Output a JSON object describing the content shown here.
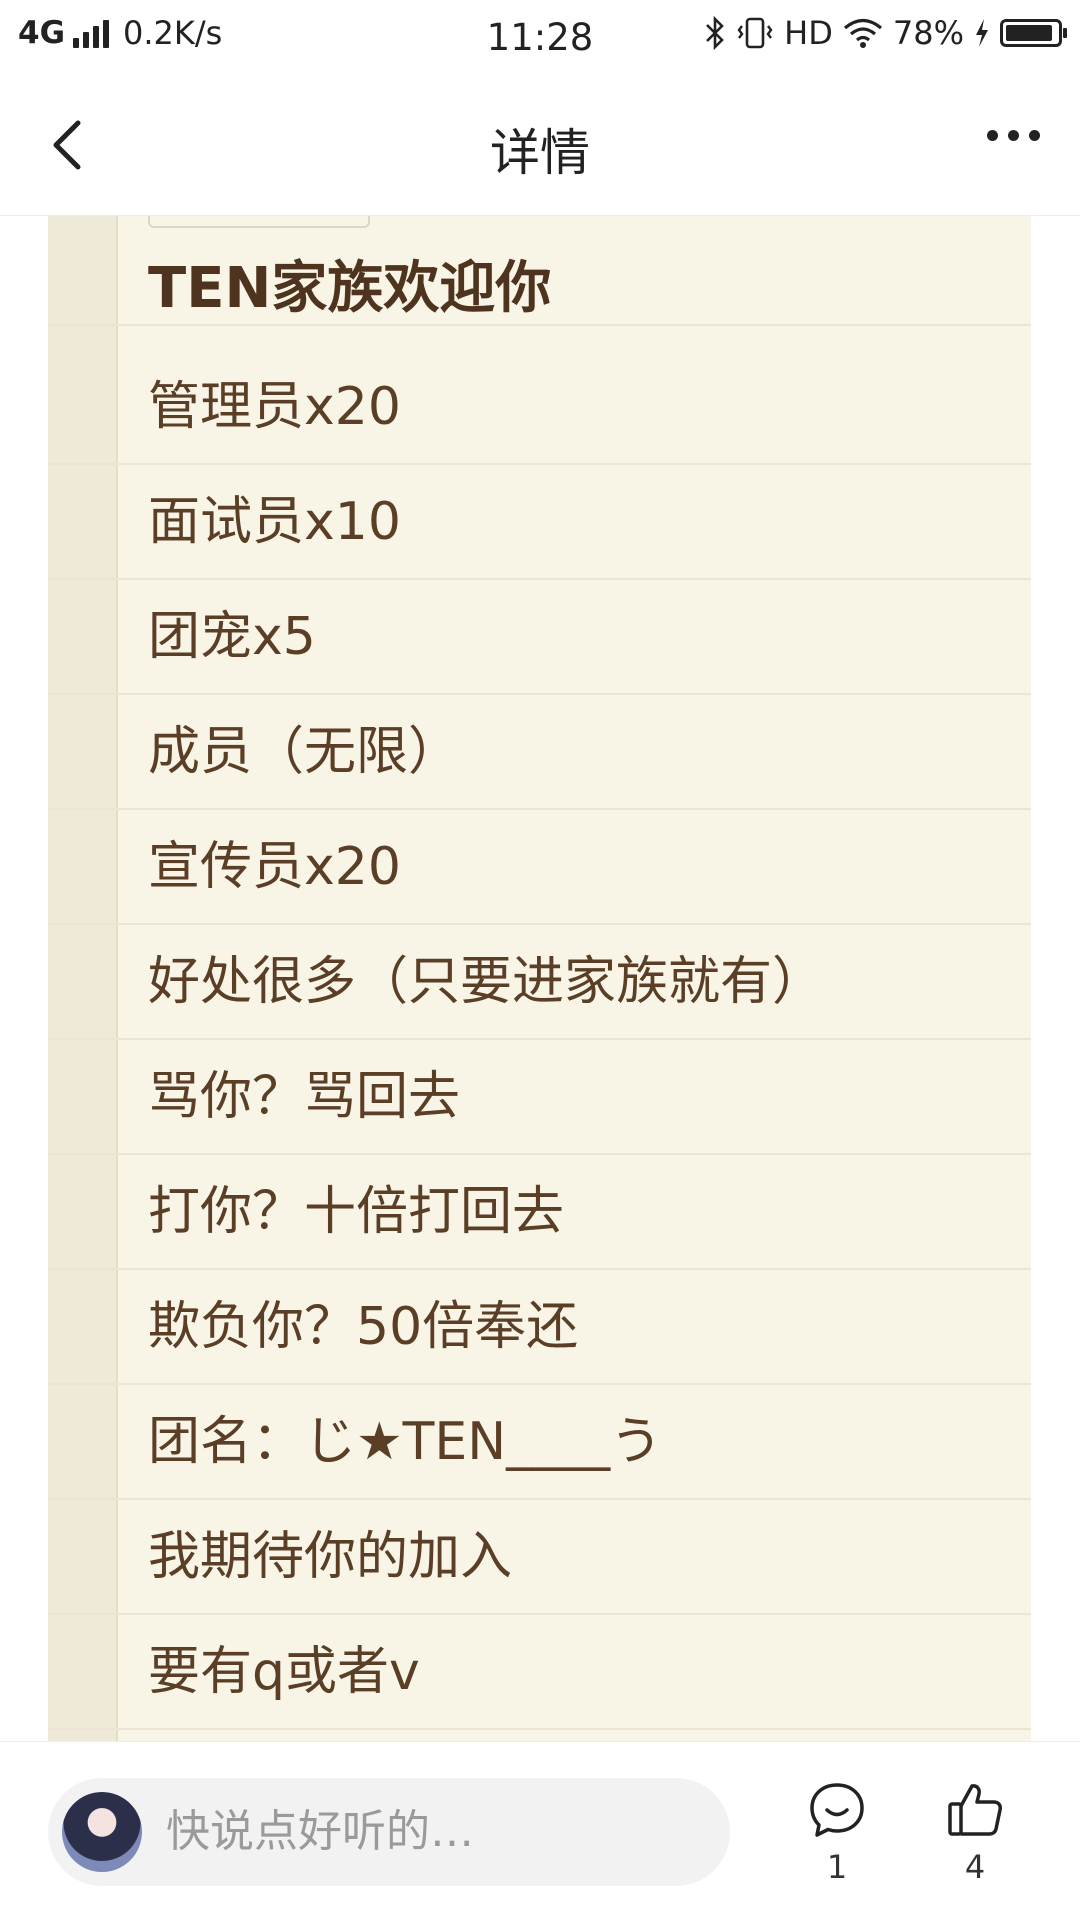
{
  "status_bar": {
    "network": "4G",
    "speed": "0.2K/s",
    "time": "11:28",
    "hd": "HD",
    "battery": "78%",
    "icons": [
      "signal-icon",
      "bluetooth-icon",
      "vibrate-icon",
      "wifi-icon",
      "charging-icon",
      "battery-icon"
    ]
  },
  "nav": {
    "title": "详情",
    "back_icon": "back-chevron-icon",
    "more_icon": "more-icon"
  },
  "note": {
    "heading": "TEN家族欢迎你",
    "lines": [
      "管理员x20",
      "面试员x10",
      "团宠x5",
      "成员（无限）",
      "宣传员x20",
      "好处很多（只要进家族就有）",
      "骂你？骂回去",
      "打你？十倍打回去",
      "欺负你？50倍奉还",
      "团名：じ★TEN____う",
      "我期待你的加入",
      "要有q或者v"
    ]
  },
  "bottom": {
    "comment_placeholder": "快说点好听的…",
    "comment_count": "1",
    "like_count": "4"
  }
}
